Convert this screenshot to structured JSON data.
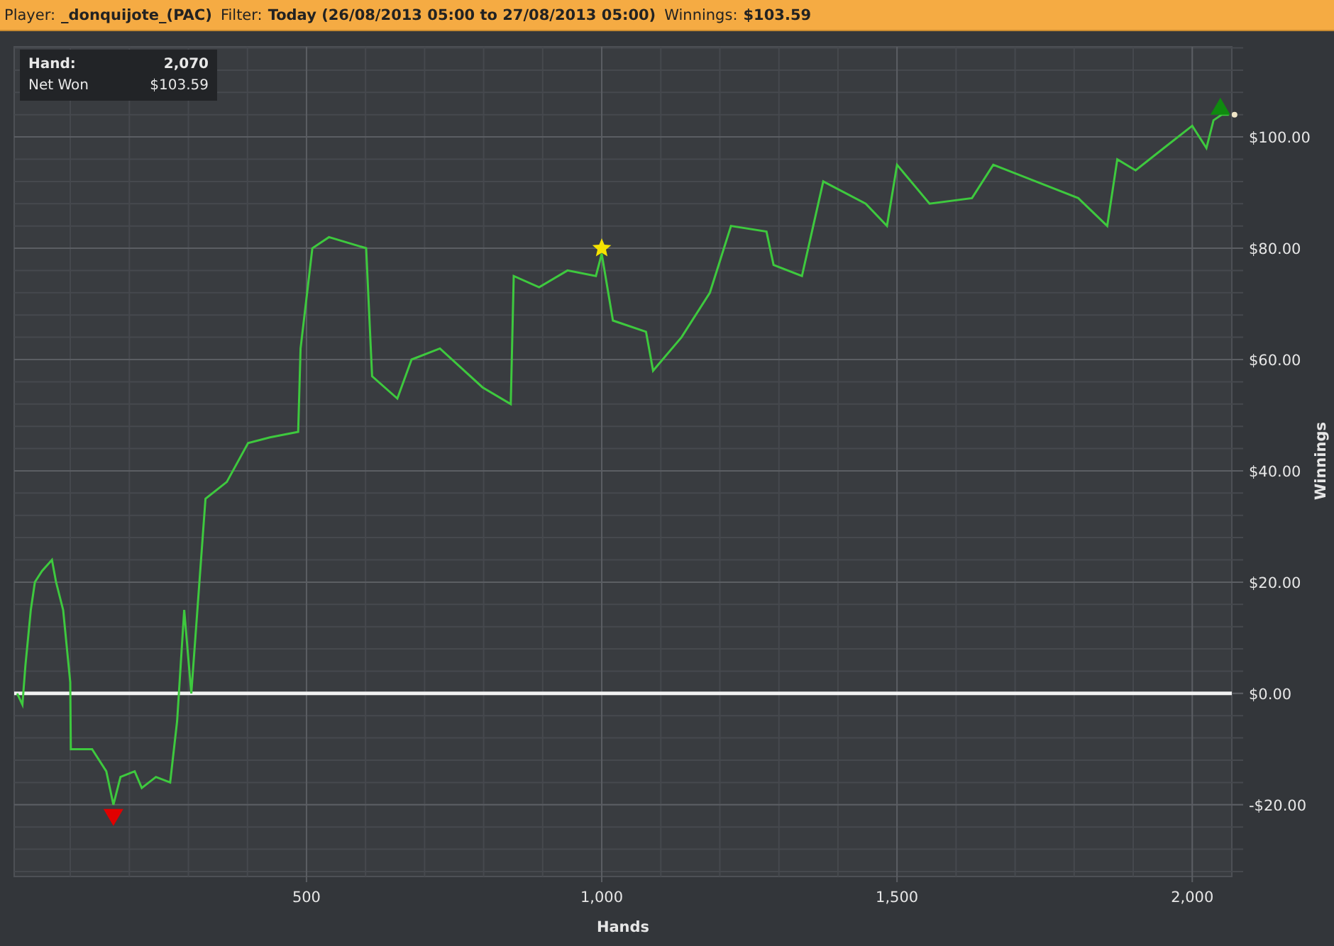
{
  "header": {
    "fields": [
      {
        "label": "Player:",
        "value": "_donquijote_(PAC)"
      },
      {
        "label": "Filter:",
        "value": "Today (26/08/2013 05:00 to 27/08/2013 05:00)"
      },
      {
        "label": "Winnings:",
        "value": "$103.59"
      }
    ]
  },
  "info_box": {
    "rows": [
      {
        "label": "Hand:",
        "value": "2,070"
      },
      {
        "label": "Net Won",
        "value": "$103.59"
      }
    ]
  },
  "chart_data": {
    "type": "line",
    "xlabel": "Hands",
    "ylabel": "Winnings",
    "xlim": [
      5,
      2067
    ],
    "ylim": [
      -32.9,
      116.2
    ],
    "xticks": [
      {
        "value": 500,
        "label": "500"
      },
      {
        "value": 1000,
        "label": "1,000"
      },
      {
        "value": 1500,
        "label": "1,500"
      },
      {
        "value": 2000,
        "label": "2,000"
      }
    ],
    "yticks": [
      {
        "value": -20,
        "label": "-$20.00"
      },
      {
        "value": 0,
        "label": "$0.00"
      },
      {
        "value": 20,
        "label": "$20.00"
      },
      {
        "value": 40,
        "label": "$40.00"
      },
      {
        "value": 60,
        "label": "$60.00"
      },
      {
        "value": 80,
        "label": "$80.00"
      },
      {
        "value": 100,
        "label": "$100.00"
      }
    ],
    "x": [
      10,
      19,
      24,
      33,
      40,
      52,
      69,
      76,
      88,
      100,
      101,
      137,
      161,
      173,
      185,
      209,
      221,
      245,
      269,
      281,
      293,
      305,
      329,
      365,
      401,
      438,
      486,
      490,
      510,
      538,
      601,
      611,
      654,
      678,
      726,
      798,
      846,
      851,
      894,
      942,
      990,
      1000,
      1019,
      1075,
      1087,
      1135,
      1183,
      1219,
      1279,
      1291,
      1339,
      1375,
      1447,
      1483,
      1500,
      1555,
      1627,
      1663,
      1735,
      1807,
      1856,
      1873,
      1904,
      1952,
      2000,
      2024,
      2036,
      2050,
      2062
    ],
    "grid": true,
    "series": [
      {
        "color": "#3ec93e",
        "values": [
          0,
          -2,
          5,
          15,
          20,
          22,
          24,
          20,
          15,
          2,
          -10,
          -10,
          -14,
          -20,
          -15,
          -14,
          -17,
          -15,
          -16,
          -5,
          15,
          0,
          35,
          38,
          45,
          46,
          47,
          62,
          80,
          82,
          80,
          57,
          53,
          60,
          62,
          55,
          52,
          75,
          73,
          76,
          75,
          79,
          67,
          65,
          58,
          64,
          72,
          84,
          83,
          77,
          75,
          92,
          88,
          84,
          95,
          88,
          89,
          95,
          92,
          89,
          84,
          96,
          94,
          98,
          102,
          98,
          103,
          104,
          104
        ]
      }
    ]
  },
  "markers": [
    {
      "kind": "down",
      "color": "#e00000"
    },
    {
      "kind": "star",
      "color": "#f5e300"
    },
    {
      "kind": "up",
      "color": "#0f8a0f"
    },
    {
      "kind": "dot",
      "color": "#f0e6c8"
    }
  ]
}
